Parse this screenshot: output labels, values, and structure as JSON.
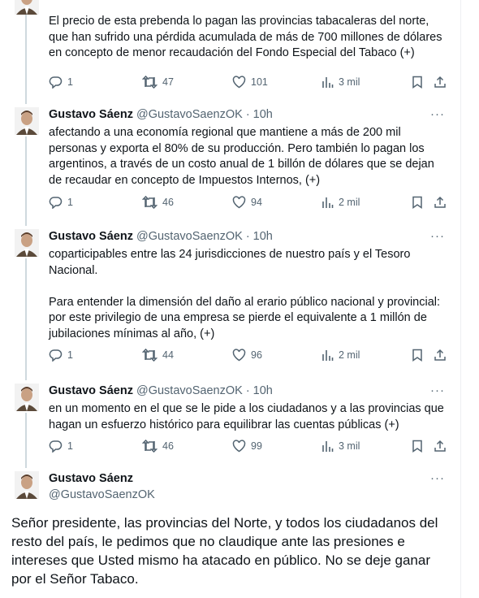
{
  "tweets": [
    {
      "name": "",
      "handle": "",
      "time": "",
      "text": "El precio de esta prebenda lo pagan las provincias tabacaleras del norte,\nque han sufrido una pérdida acumulada de más de 700 millones de dólares\nen concepto de menor recaudación del Fondo Especial del Tabaco (+)",
      "replies": "1",
      "retweets": "47",
      "likes": "101",
      "views": "3 mil"
    },
    {
      "name": "Gustavo Sáenz",
      "handle": "@GustavoSaenzOK",
      "time": "· 10h",
      "text": "afectando a una economía regional que mantiene a más de 200 mil\npersonas y exporta el 80% de su producción. Pero también lo pagan los\nargentinos, a través de un costo anual de 1 billón de dólares que se dejan\nde recaudar en concepto de Impuestos Internos, (+)",
      "replies": "1",
      "retweets": "46",
      "likes": "94",
      "views": "2 mil"
    },
    {
      "name": "Gustavo Sáenz",
      "handle": "@GustavoSaenzOK",
      "time": "· 10h",
      "text": "coparticipables entre las 24 jurisdicciones de nuestro país y el Tesoro\nNacional.\n\nPara entender la dimensión del daño al erario público nacional y provincial:\npor este privilegio de una empresa se pierde el equivalente a 1 millón de\njubilaciones mínimas al año, (+)",
      "replies": "1",
      "retweets": "44",
      "likes": "96",
      "views": "2 mil"
    },
    {
      "name": "Gustavo Sáenz",
      "handle": "@GustavoSaenzOK",
      "time": "· 10h",
      "text": "en un momento en el que se le pide a los ciudadanos y a las provincias que\nhagan un esfuerzo histórico para equilibrar las cuentas públicas (+)",
      "replies": "1",
      "retweets": "46",
      "likes": "99",
      "views": "3 mil"
    }
  ],
  "final_tweet": {
    "name": "Gustavo Sáenz",
    "handle": "@GustavoSaenzOK",
    "text": "Señor presidente, las provincias del Norte, y todos los ciudadanos del resto del país, le pedimos que no claudique ante las presiones e intereses que Usted mismo ha atacado en público. No se deje ganar por el Señor Tabaco."
  },
  "more_glyph": "···",
  "colors": {
    "text": "#0f1419",
    "muted": "#536471",
    "thread": "#cfd9de"
  }
}
